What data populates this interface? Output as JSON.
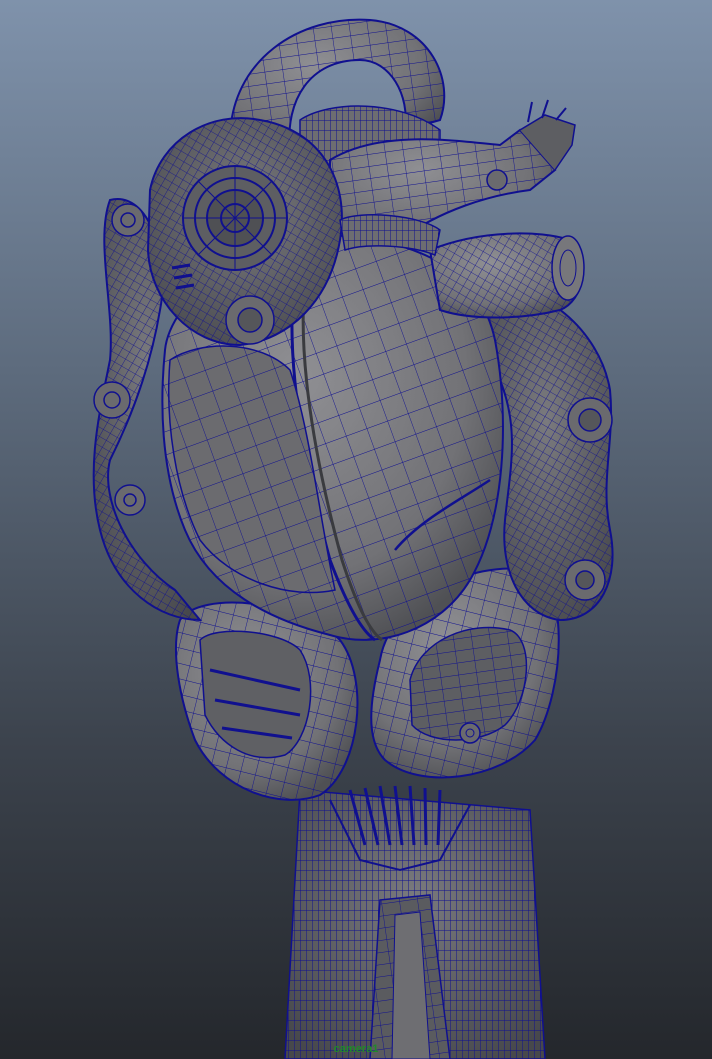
{
  "viewport": {
    "camera_name": "camera1",
    "label_color": "#1f8a2a",
    "wire_color": "#10108f",
    "surface_color": "#77777b",
    "surface_dark": "#55565a",
    "surface_light": "#8c8c90",
    "bg_top": "#7f92ab",
    "bg_bottom": "#24272c"
  }
}
